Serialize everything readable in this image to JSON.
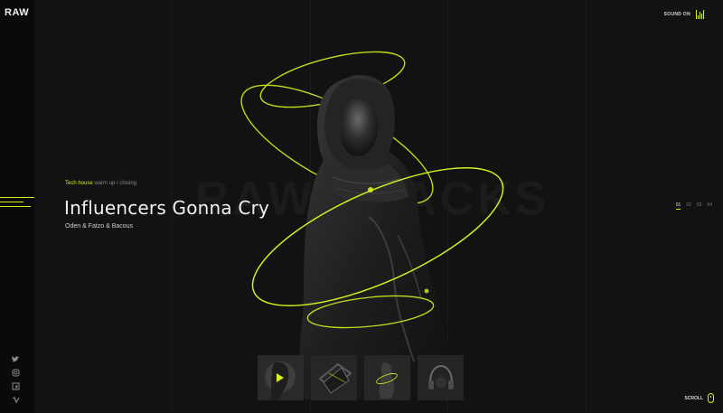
{
  "brand": {
    "logo": "RAW"
  },
  "sound": {
    "label": "SOUND ON",
    "icon": "equalizer-icon"
  },
  "hero": {
    "watermark": "RAW TRACKS",
    "genre_accent": "Tech house",
    "genre_rest": "warm up / closing",
    "title": "Influencers Gonna Cry",
    "artists": "Oden & Fatzo & Bacous"
  },
  "pager": {
    "items": [
      "01",
      "02",
      "03",
      "04"
    ],
    "active_index": 0
  },
  "scroll": {
    "label": "SCROLL",
    "icon": "mouse-icon"
  },
  "social": [
    "twitter-icon",
    "instagram-icon",
    "facebook-icon",
    "vimeo-icon"
  ],
  "thumbnails": [
    {
      "name": "track-thumbnail-1",
      "active": true,
      "icon": "play-icon"
    },
    {
      "name": "track-thumbnail-2",
      "active": false
    },
    {
      "name": "track-thumbnail-3",
      "active": false
    },
    {
      "name": "track-thumbnail-4",
      "active": false
    }
  ],
  "colors": {
    "accent": "#d7ef1e",
    "background": "#121212",
    "sidebar": "#0a0a0a",
    "text": "#f1f1f1"
  }
}
